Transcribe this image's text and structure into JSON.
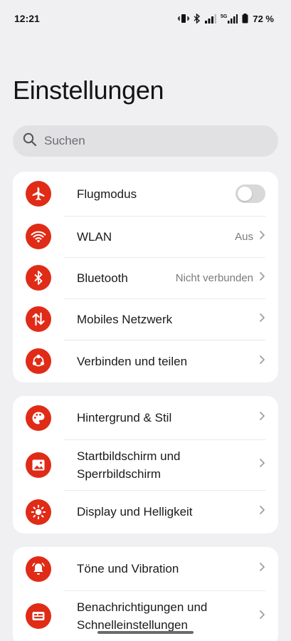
{
  "status_bar": {
    "time": "12:21",
    "network_5g": "5G",
    "battery": "72 %"
  },
  "page_title": "Einstellungen",
  "search": {
    "placeholder": "Suchen"
  },
  "groups": [
    {
      "items": [
        {
          "id": "flugmodus",
          "icon": "airplane-icon",
          "label": "Flugmodus",
          "control": "toggle",
          "toggle_on": false
        },
        {
          "id": "wlan",
          "icon": "wifi-icon",
          "label": "WLAN",
          "value": "Aus"
        },
        {
          "id": "bluetooth",
          "icon": "bluetooth-icon",
          "label": "Bluetooth",
          "value": "Nicht verbunden"
        },
        {
          "id": "mobiles-netzwerk",
          "icon": "mobile-data-icon",
          "label": "Mobiles Netzwerk"
        },
        {
          "id": "verbinden-teilen",
          "icon": "share-nodes-icon",
          "label": "Verbinden und teilen"
        }
      ]
    },
    {
      "items": [
        {
          "id": "hintergrund-stil",
          "icon": "palette-icon",
          "label": "Hintergrund & Stil"
        },
        {
          "id": "startbildschirm",
          "icon": "wallpaper-icon",
          "label": "Startbildschirm und Sperrbildschirm"
        },
        {
          "id": "display",
          "icon": "brightness-icon",
          "label": "Display und Helligkeit"
        }
      ]
    },
    {
      "items": [
        {
          "id": "toene",
          "icon": "bell-icon",
          "label": "Töne und Vibration"
        },
        {
          "id": "benachrichtigungen",
          "icon": "notification-icon",
          "label": "Benachrichtigungen und Schnelleinstellungen"
        }
      ]
    }
  ],
  "colors": {
    "accent": "#e02b17",
    "background": "#f0f0f2",
    "card": "#ffffff"
  }
}
